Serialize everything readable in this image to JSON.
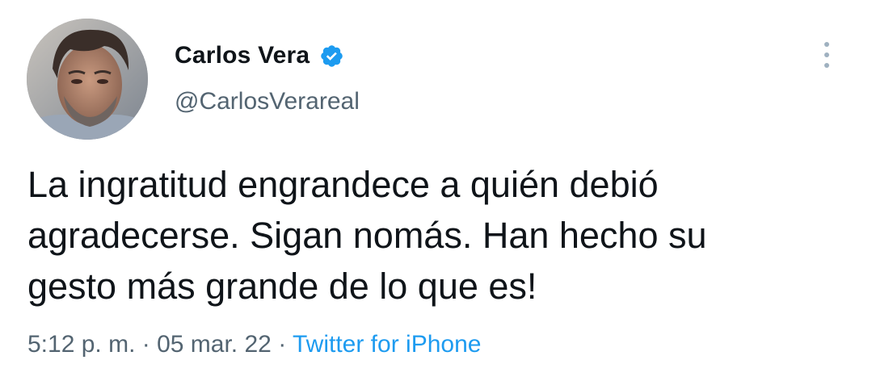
{
  "author": {
    "display_name": "Carlos Vera",
    "handle": "@CarlosVerareal",
    "verified_icon": "verified-badge-icon",
    "avatar": "profile-photo"
  },
  "tweet": {
    "lines": [
      "La ingratitud engrandece a quién debió",
      "agradecerse. Sigan nomás. Han hecho su",
      "gesto más grande de lo que es!"
    ],
    "time": "5:12 p. m.",
    "separator": "·",
    "date": "05 mar. 22",
    "source": "Twitter for iPhone"
  },
  "menu_icon": "more-vertical-icon",
  "colors": {
    "text": "#0f1419",
    "secondary": "#536471",
    "accent": "#1d9bf0"
  }
}
